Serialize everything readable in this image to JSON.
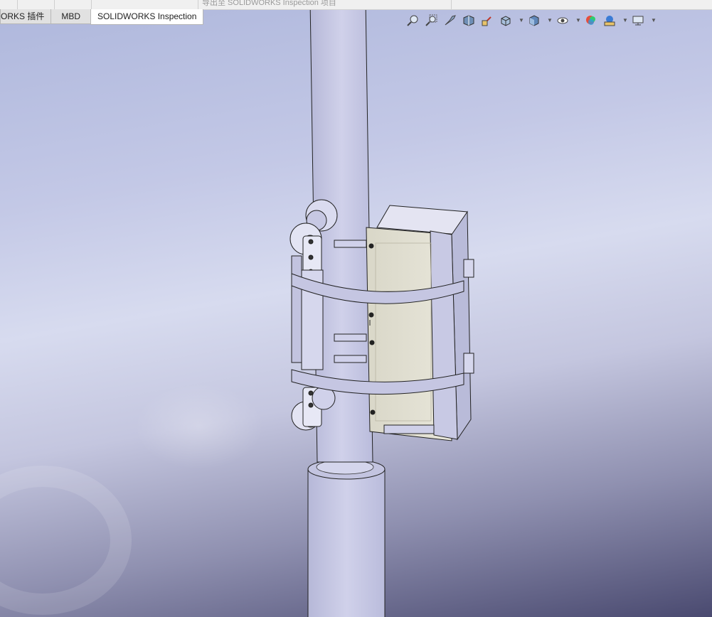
{
  "top_hint": "导出至 SOLIDWORKS Inspection 项目",
  "tabs": [
    {
      "label": "ORKS 插件",
      "active": false
    },
    {
      "label": "MBD",
      "active": false
    },
    {
      "label": "SOLIDWORKS Inspection",
      "active": true
    }
  ],
  "toolbar": {
    "icons": [
      "zoom-to-fit-icon",
      "zoom-to-area-icon",
      "previous-view-icon",
      "section-view-icon",
      "dynamic-annotation-icon",
      "view-orientation-icon",
      "display-style-icon",
      "hide-show-items-icon",
      "edit-appearance-icon",
      "apply-scene-icon",
      "view-settings-icon"
    ]
  },
  "colors": {
    "viewport_top": "#aeb7dc",
    "viewport_bottom": "#4a4a70",
    "part_face": "#c8c9e6",
    "enclosure_face": "#dcdacd"
  }
}
